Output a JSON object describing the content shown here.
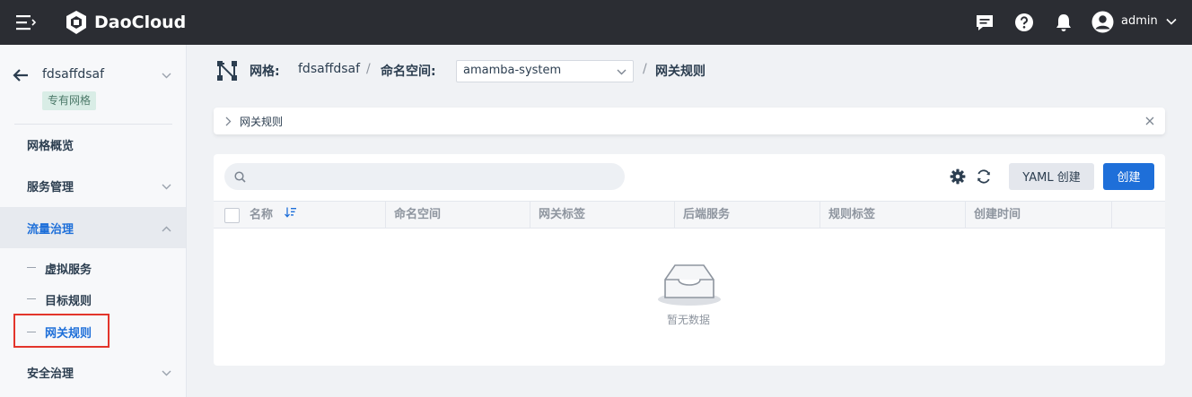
{
  "header": {
    "brand": "DaoCloud",
    "user": "admin"
  },
  "sidebar": {
    "mesh_name": "fdsaffdsaf",
    "mesh_badge": "专有网格",
    "items": [
      {
        "label": "网格概览"
      },
      {
        "label": "服务管理"
      },
      {
        "label": "流量治理"
      },
      {
        "label": "安全治理"
      }
    ],
    "sub_items": [
      {
        "label": "虚拟服务"
      },
      {
        "label": "目标规则"
      },
      {
        "label": "网关规则"
      }
    ]
  },
  "breadcrumb": {
    "mesh_label": "网格:",
    "mesh_value": "fdsaffdsaf",
    "sep": "/",
    "namespace_label": "命名空间:",
    "namespace_value": "amamba-system",
    "current": "网关规则"
  },
  "banner": {
    "title": "网关规则"
  },
  "toolbar": {
    "search_placeholder": "",
    "yaml_create_label": "YAML 创建",
    "create_label": "创建"
  },
  "table": {
    "columns": [
      "名称",
      "命名空间",
      "网关标签",
      "后端服务",
      "规则标签",
      "创建时间"
    ],
    "rows": [],
    "empty_text": "暂无数据"
  },
  "colors": {
    "topbar": "#2b2d33",
    "accent": "#1e6fd9",
    "highlight_box": "#e3352b",
    "badge_bg": "#d9ede6",
    "badge_text": "#4d7a6a"
  }
}
